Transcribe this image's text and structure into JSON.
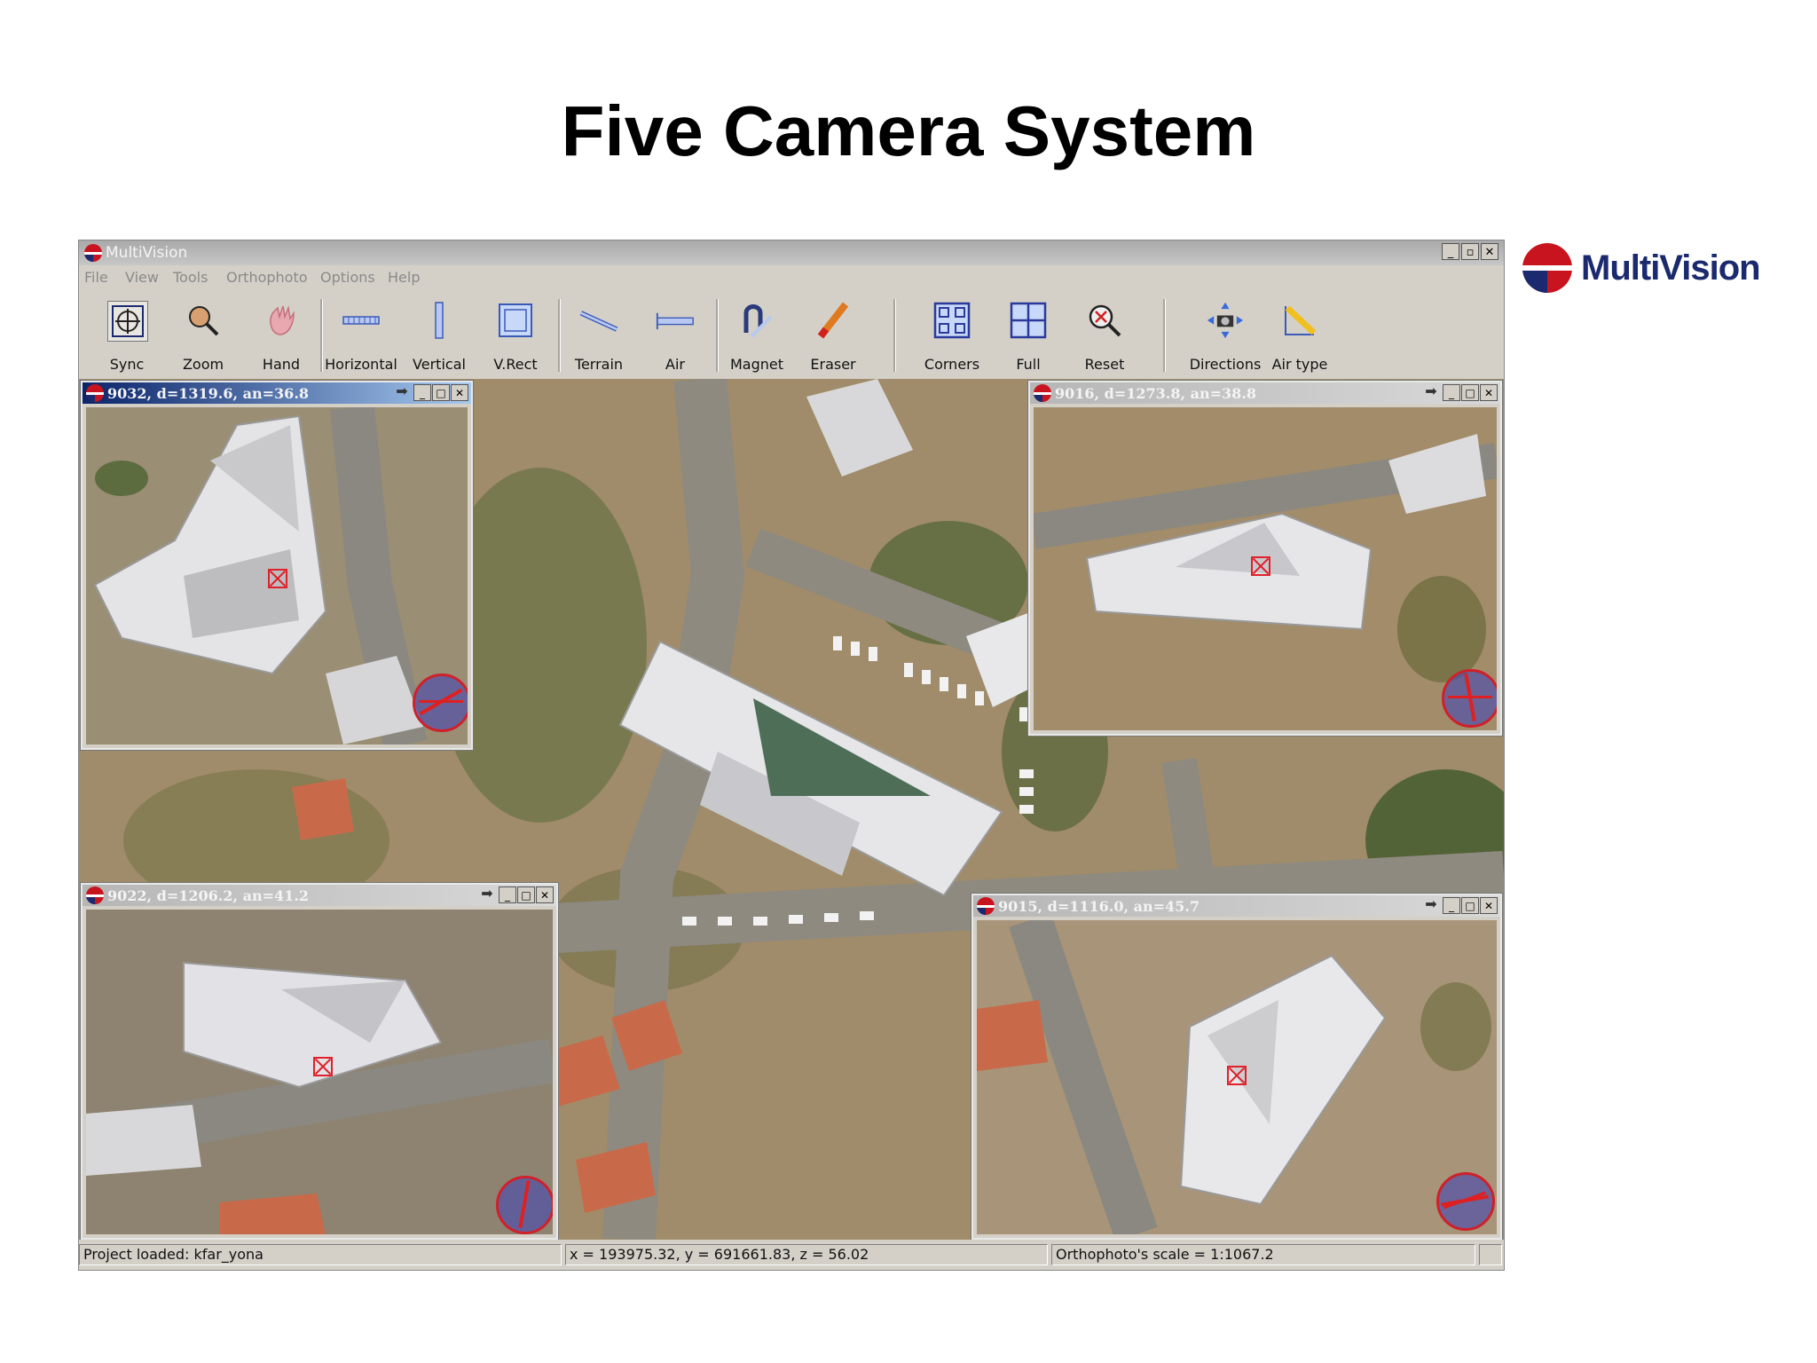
{
  "slide": {
    "title": "Five Camera System"
  },
  "brand": {
    "name": "MultiVision"
  },
  "window": {
    "title": "MultiVision",
    "controls": [
      "_",
      "▫",
      "✕"
    ]
  },
  "menu": [
    "File",
    "View",
    "Tools",
    "Orthophoto",
    "Options",
    "Help"
  ],
  "toolbar": [
    {
      "label": "Sync",
      "icon": "sync-icon",
      "active": true
    },
    {
      "label": "Zoom",
      "icon": "zoom-icon"
    },
    {
      "label": "Hand",
      "icon": "hand-icon"
    },
    {
      "label": "Horizontal",
      "icon": "horizontal-icon"
    },
    {
      "label": "Vertical",
      "icon": "vertical-icon"
    },
    {
      "label": "V.Rect",
      "icon": "vrect-icon"
    },
    {
      "label": "Terrain",
      "icon": "terrain-icon"
    },
    {
      "label": "Air",
      "icon": "air-icon"
    },
    {
      "label": "Magnet",
      "icon": "magnet-icon"
    },
    {
      "label": "Eraser",
      "icon": "eraser-icon"
    },
    {
      "label": "Corners",
      "icon": "corners-icon"
    },
    {
      "label": "Full",
      "icon": "full-icon"
    },
    {
      "label": "Reset",
      "icon": "reset-icon"
    },
    {
      "label": "Directions",
      "icon": "directions-icon"
    },
    {
      "label": "Air type",
      "icon": "air-type-icon"
    }
  ],
  "subwindows": [
    {
      "title": "9032, d=1319.6, an=36.8"
    },
    {
      "title": "9016, d=1273.8, an=38.8"
    },
    {
      "title": "9022, d=1206.2, an=41.2"
    },
    {
      "title": "9015, d=1116.0, an=45.7"
    }
  ],
  "status": {
    "project": "Project loaded: kfar_yona",
    "coords": "x = 193975.32, y = 691661.83, z = 56.02",
    "scale": "Orthophoto's scale = 1:1067.2"
  },
  "colors": {
    "brand_red": "#c8141e",
    "brand_blue": "#1b2a6e",
    "active_title": "#0a246a",
    "target": "#e0202a"
  }
}
